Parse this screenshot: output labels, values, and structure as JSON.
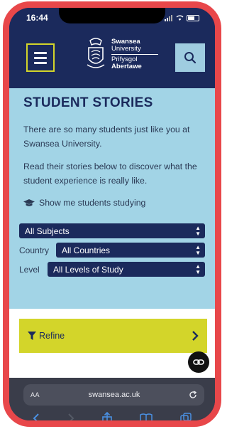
{
  "status": {
    "time": "16:44"
  },
  "header": {
    "logo_line1": "Swansea",
    "logo_line2": "University",
    "logo_line3": "Prifysgol",
    "logo_line4": "Abertawe"
  },
  "main": {
    "title": "STUDENT STORIES",
    "intro1": "There are so many students just like you at Swansea University.",
    "intro2": "Read their stories below to discover what the student experience is really like.",
    "show_me": "Show me students studying"
  },
  "filters": {
    "subjects_value": "All Subjects",
    "country_label": "Country",
    "country_value": "All Countries",
    "level_label": "Level",
    "level_value": "All Levels of Study"
  },
  "refine": {
    "label": "Refine"
  },
  "browser": {
    "aa": "AA",
    "url": "swansea.ac.uk"
  },
  "colors": {
    "navy": "#1b2a5c",
    "sky": "#a2d4e6",
    "lime": "#d3d52a",
    "frame_red": "#e8474a"
  }
}
